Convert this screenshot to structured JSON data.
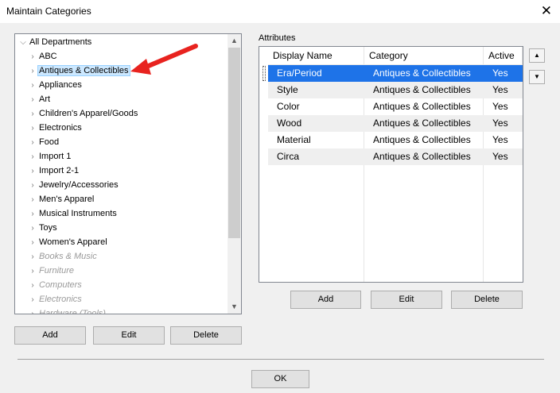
{
  "window": {
    "title": "Maintain Categories",
    "close_glyph": "✕"
  },
  "tree": {
    "root_label": "All Departments",
    "items": [
      {
        "label": "ABC",
        "enabled": true
      },
      {
        "label": "Antiques & Collectibles",
        "enabled": true,
        "selected": true
      },
      {
        "label": "Appliances",
        "enabled": true
      },
      {
        "label": "Art",
        "enabled": true
      },
      {
        "label": "Children's Apparel/Goods",
        "enabled": true
      },
      {
        "label": "Electronics",
        "enabled": true
      },
      {
        "label": "Food",
        "enabled": true
      },
      {
        "label": "Import 1",
        "enabled": true
      },
      {
        "label": "Import 2-1",
        "enabled": true
      },
      {
        "label": "Jewelry/Accessories",
        "enabled": true
      },
      {
        "label": "Men's Apparel",
        "enabled": true
      },
      {
        "label": "Musical Instruments",
        "enabled": true
      },
      {
        "label": "Toys",
        "enabled": true
      },
      {
        "label": "Women's Apparel",
        "enabled": true
      },
      {
        "label": "Books & Music",
        "enabled": false
      },
      {
        "label": "Furniture",
        "enabled": false
      },
      {
        "label": "Computers",
        "enabled": false
      },
      {
        "label": "Electronics",
        "enabled": false
      },
      {
        "label": "Hardware (Tools)",
        "enabled": false
      }
    ],
    "buttons": {
      "add": "Add",
      "edit": "Edit",
      "delete": "Delete"
    }
  },
  "attributes": {
    "label": "Attributes",
    "columns": [
      "Display Name",
      "Category",
      "Active"
    ],
    "rows": [
      {
        "name": "Era/Period",
        "category": "Antiques & Collectibles",
        "active": "Yes",
        "selected": true
      },
      {
        "name": "Style",
        "category": "Antiques & Collectibles",
        "active": "Yes"
      },
      {
        "name": "Color",
        "category": "Antiques & Collectibles",
        "active": "Yes"
      },
      {
        "name": "Wood",
        "category": "Antiques & Collectibles",
        "active": "Yes"
      },
      {
        "name": "Material",
        "category": "Antiques & Collectibles",
        "active": "Yes"
      },
      {
        "name": "Circa",
        "category": "Antiques & Collectibles",
        "active": "Yes"
      }
    ],
    "buttons": {
      "add": "Add",
      "edit": "Edit",
      "delete": "Delete"
    },
    "move_up_glyph": "▲",
    "move_down_glyph": "▼"
  },
  "footer": {
    "ok": "OK"
  },
  "colors": {
    "selection": "#1e73e8",
    "tree_selection": "#cce8ff",
    "annotation_arrow": "#e8231f"
  }
}
